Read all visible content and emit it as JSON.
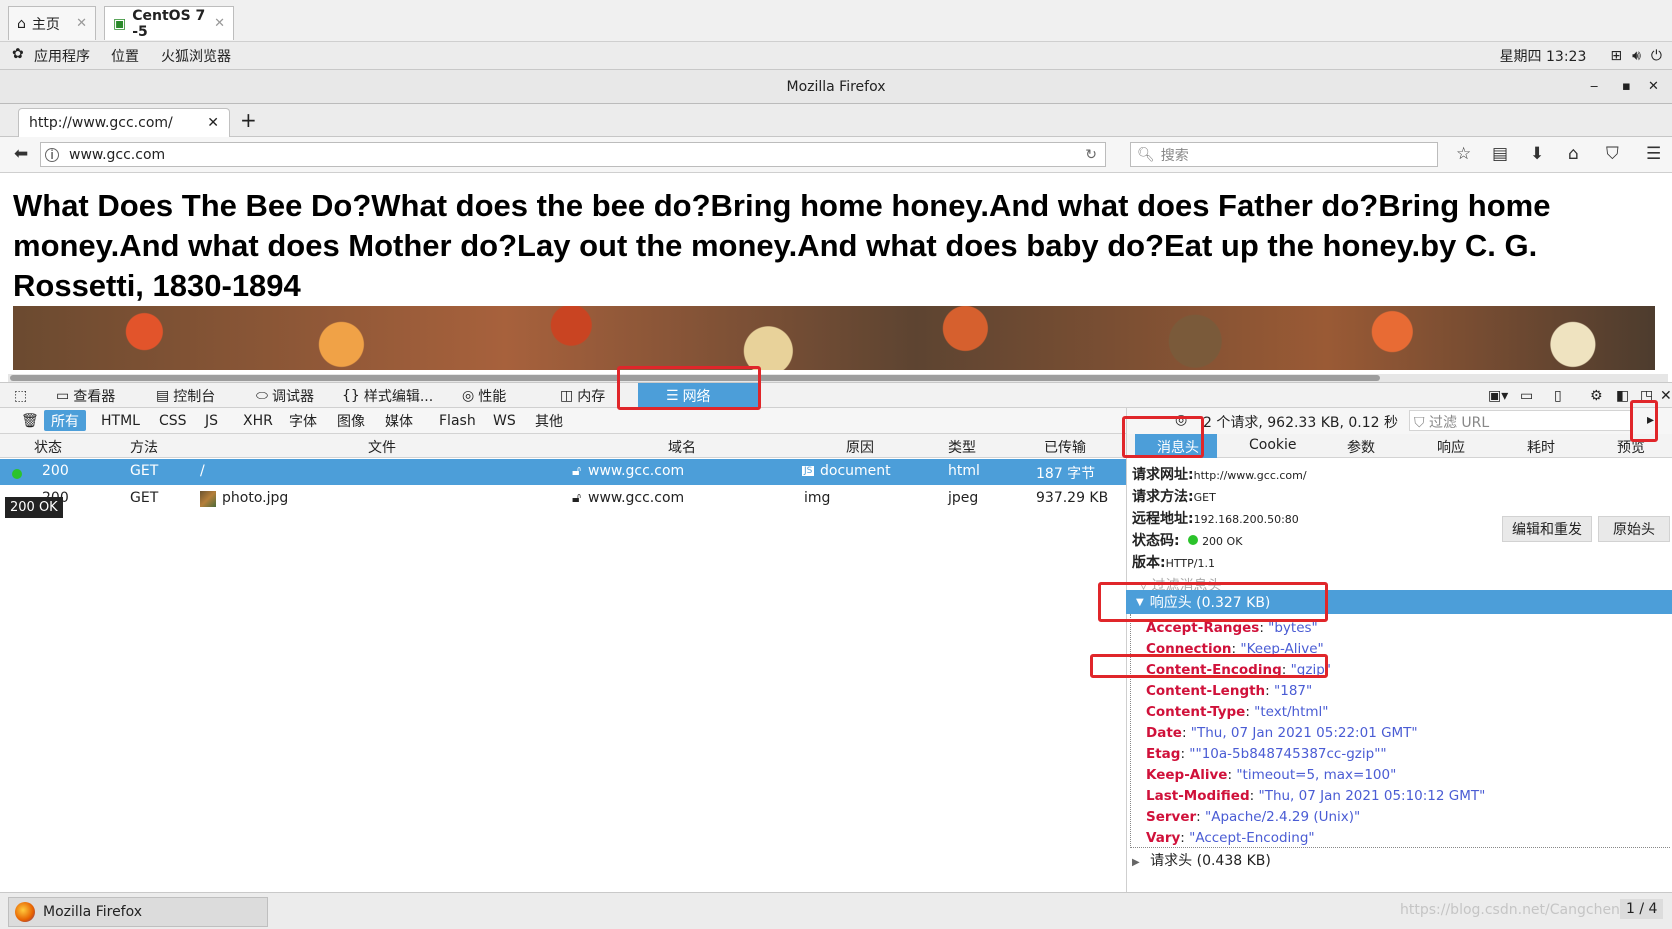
{
  "vm_tabs": [
    {
      "label": "主页",
      "icon": "home-icon"
    },
    {
      "label": "CentOS 7 -5",
      "icon": "vm-play-icon"
    }
  ],
  "gnome": {
    "menus": [
      "应用程序",
      "位置",
      "火狐浏览器"
    ],
    "clock": "星期四 13:23"
  },
  "window": {
    "title": "Mozilla Firefox"
  },
  "firefox": {
    "tab_title": "http://www.gcc.com/",
    "url": "www.gcc.com",
    "search_placeholder": "搜索"
  },
  "page": {
    "text": "What Does The Bee Do?What does the bee do?Bring home honey.And what does Father do?Bring home money.And what does Mother do?Lay out the money.And what does baby do?Eat up the honey.by C. G. Rossetti, 1830-1894"
  },
  "devtools": {
    "tabs": [
      "查看器",
      "控制台",
      "调试器",
      "样式编辑...",
      "性能",
      "内存",
      "网络"
    ],
    "active_tab": "网络",
    "filters": [
      "所有",
      "HTML",
      "CSS",
      "JS",
      "XHR",
      "字体",
      "图像",
      "媒体",
      "Flash",
      "WS",
      "其他"
    ],
    "active_filter": "所有",
    "summary": "2 个请求, 962.33 KB, 0.12 秒",
    "url_filter_placeholder": "过滤 URL",
    "columns": [
      "状态",
      "方法",
      "文件",
      "域名",
      "原因",
      "类型",
      "已传输"
    ],
    "requests": [
      {
        "status": "200",
        "method": "GET",
        "file": "/",
        "domain": "www.gcc.com",
        "cause": "document",
        "type": "html",
        "transferred": "187 字节"
      },
      {
        "status": "200",
        "method": "GET",
        "file": "photo.jpg",
        "domain": "www.gcc.com",
        "cause": "img",
        "type": "jpeg",
        "transferred": "937.29 KB"
      }
    ],
    "tooltip": "200 OK",
    "detail_tabs": [
      "消息头",
      "Cookie",
      "参数",
      "响应",
      "耗时",
      "预览"
    ],
    "active_detail_tab": "消息头",
    "general": {
      "url_label": "请求网址:",
      "url": "http://www.gcc.com/",
      "method_label": "请求方法:",
      "method": "GET",
      "remote_label": "远程地址:",
      "remote": "192.168.200.50:80",
      "status_label": "状态码:",
      "status": "200 OK",
      "version_label": "版本:",
      "version": "HTTP/1.1"
    },
    "buttons": {
      "edit_resend": "编辑和重发",
      "raw_headers": "原始头"
    },
    "filter_headers_placeholder": "过滤消息头",
    "response_headers_title": "响应头 (0.327 KB)",
    "response_headers": [
      {
        "k": "Accept-Ranges",
        "v": "\"bytes\""
      },
      {
        "k": "Connection",
        "v": "\"Keep-Alive\""
      },
      {
        "k": "Content-Encoding",
        "v": "\"gzip\""
      },
      {
        "k": "Content-Length",
        "v": "\"187\""
      },
      {
        "k": "Content-Type",
        "v": "\"text/html\""
      },
      {
        "k": "Date",
        "v": "\"Thu, 07 Jan 2021 05:22:01 GMT\""
      },
      {
        "k": "Etag",
        "v": "\"\"10a-5b848745387cc-gzip\"\""
      },
      {
        "k": "Keep-Alive",
        "v": "\"timeout=5, max=100\""
      },
      {
        "k": "Last-Modified",
        "v": "\"Thu, 07 Jan 2021 05:10:12 GMT\""
      },
      {
        "k": "Server",
        "v": "\"Apache/2.4.29 (Unix)\""
      },
      {
        "k": "Vary",
        "v": "\"Accept-Encoding\""
      }
    ],
    "request_headers_title": "请求头 (0.438 KB)"
  },
  "taskbar": {
    "item": "Mozilla Firefox",
    "watermark": "https://blog.csdn.net/Cangchenglong",
    "pager": "1 / 4"
  },
  "colors": {
    "accent": "#4c9ed9",
    "annotation": "#e0262a",
    "header_key": "#d0113a",
    "header_value": "#4a5cd4"
  }
}
